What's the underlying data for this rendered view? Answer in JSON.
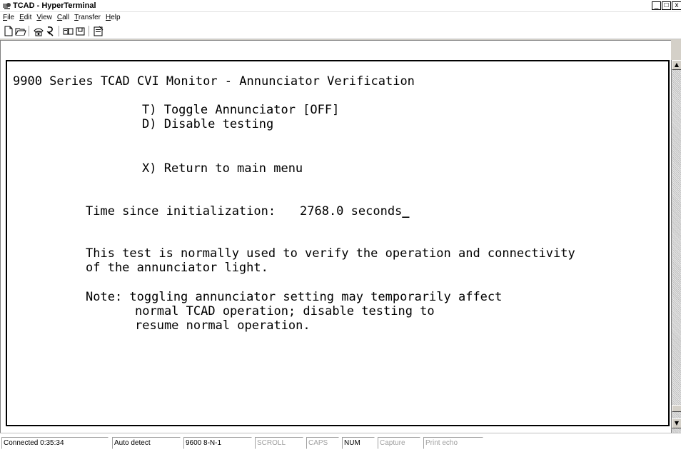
{
  "window": {
    "title": "TCAD - HyperTerminal",
    "buttons": {
      "minimize": "_",
      "maximize": "□",
      "close": "x"
    }
  },
  "menu": [
    {
      "label": "File",
      "key": "F",
      "rest": "ile"
    },
    {
      "label": "Edit",
      "key": "E",
      "rest": "dit"
    },
    {
      "label": "View",
      "key": "V",
      "rest": "iew"
    },
    {
      "label": "Call",
      "key": "C",
      "rest": "all"
    },
    {
      "label": "Transfer",
      "key": "T",
      "rest": "ransfer"
    },
    {
      "label": "Help",
      "key": "H",
      "rest": "elp"
    }
  ],
  "toolbar": [
    "new-icon",
    "open-icon",
    "connect-icon",
    "disconnect-icon",
    "send-icon",
    "receive-icon",
    "properties-icon"
  ],
  "terminal": {
    "heading": "9900 Series TCAD CVI Monitor - Annunciator Verification",
    "option_toggle": "T) Toggle Annunciator [OFF]",
    "option_disable": "D) Disable testing",
    "option_return": "X) Return to main menu",
    "time_label": "Time since initialization:",
    "time_value": "2768.0 seconds",
    "cursor": "_",
    "desc_line1": "This test is normally used to verify the operation and connectivity",
    "desc_line2": "of the annunciator light.",
    "note_line1": "Note: toggling annunciator setting may temporarily affect",
    "note_line2": "normal TCAD operation; disable testing to",
    "note_line3": "resume normal operation."
  },
  "status": {
    "connected": "Connected 0:35:34",
    "detect": "Auto detect",
    "settings": "9600 8-N-1",
    "scroll": "SCROLL",
    "caps": "CAPS",
    "num": "NUM",
    "capture": "Capture",
    "print_echo": "Print echo"
  }
}
